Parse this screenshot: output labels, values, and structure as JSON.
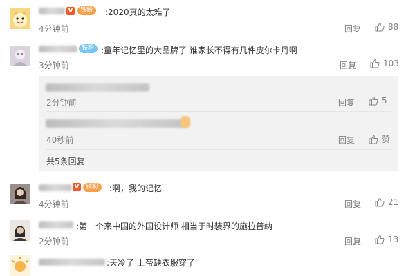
{
  "comments": [
    {
      "text": ":2020真的太难了",
      "badge_v": "V",
      "fan_label": "铁粉",
      "time": "4分钟前",
      "reply": "回复",
      "likes": "88"
    },
    {
      "text": ":童年记忆里的大品牌了 谁家长不得有几件皮尔卡丹啊",
      "fan_label": "铁粉",
      "time": "3分钟前",
      "reply": "回复",
      "likes": "103"
    },
    {
      "text": ":啊，我的记忆",
      "badge_v": "V",
      "fan_label": "铁粉",
      "time": "4分钟前",
      "reply": "回复",
      "likes": "21"
    },
    {
      "text": ":第一个来中国的外国设计师 相当于时装界的施拉普纳",
      "time": "2分钟前",
      "reply": "回复",
      "likes": "13"
    },
    {
      "text": ":天冷了 上帝缺衣服穿了"
    }
  ],
  "replies": [
    {
      "time": "2分钟前",
      "reply": "回复",
      "likes": "5"
    },
    {
      "time": "40秒前",
      "reply": "回复",
      "likes": "赞"
    }
  ],
  "more_replies": "共5条回复",
  "colors": {
    "orange_badge": "#f7a24a",
    "blue_badge": "#79c6ef",
    "v_badge": "#f05a28",
    "reply_bg": "#f2f2f2"
  }
}
